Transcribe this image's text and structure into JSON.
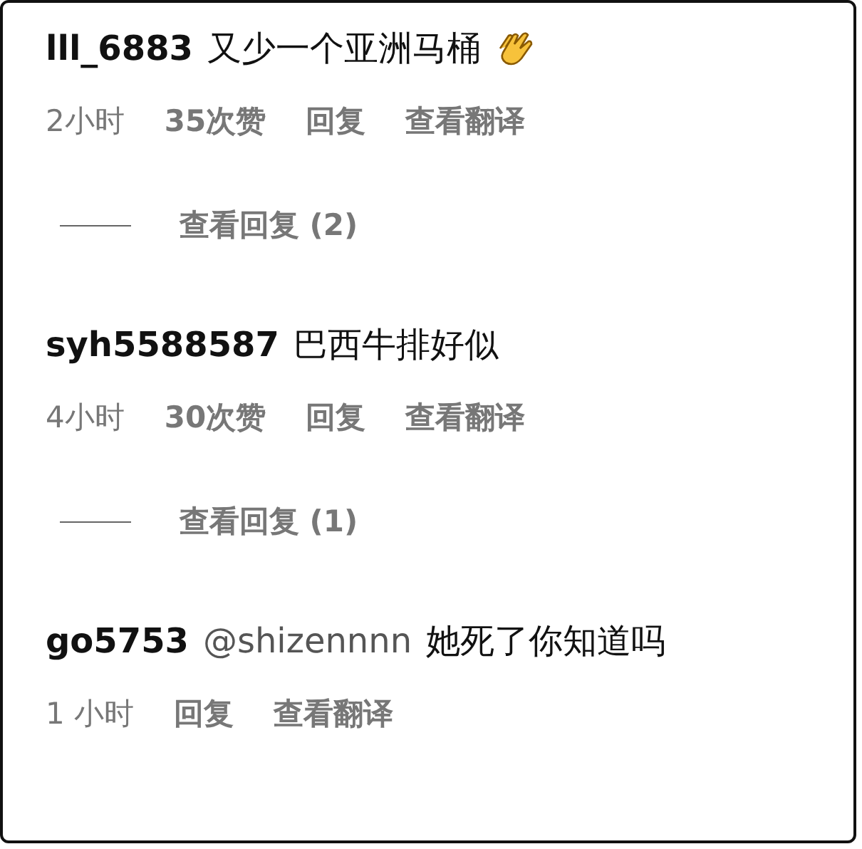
{
  "comments": [
    {
      "username": "lll_6883",
      "text": "又少一个亚洲马桶",
      "has_icon": true,
      "time": "2小时",
      "likes": "35次赞",
      "actions": [
        "回复",
        "查看翻译"
      ],
      "replies_link": "查看回复 (2)"
    },
    {
      "username": "syh5588587",
      "text": "巴西牛排好似",
      "time": "4小时",
      "likes": "30次赞",
      "actions": [
        "回复",
        "查看翻译"
      ],
      "replies_link": "查看回复 (1)"
    },
    {
      "username": "go5753",
      "mention": "@shizennnn",
      "text": "她死了你知道吗",
      "time": "1 小时",
      "actions": [
        "回复",
        "查看翻译"
      ]
    }
  ]
}
